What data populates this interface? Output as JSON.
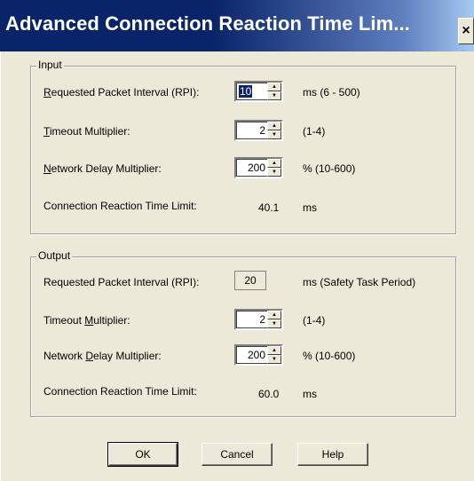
{
  "window": {
    "title": "Advanced Connection Reaction Time Lim...",
    "close_label": "×"
  },
  "input": {
    "legend": "Input",
    "rpi": {
      "label_pre": "",
      "label_ul": "R",
      "label_post": "equested Packet Interval (RPI):",
      "value": "10",
      "units": "ms (6 - 500)"
    },
    "timeout": {
      "label_pre": "",
      "label_ul": "T",
      "label_post": "imeout Multiplier:",
      "value": "2",
      "units": "(1-4)"
    },
    "delay": {
      "label_pre": "",
      "label_ul": "N",
      "label_post": "etwork Delay Multiplier:",
      "value": "200",
      "units": "% (10-600)"
    },
    "crtl": {
      "label": "Connection Reaction Time Limit:",
      "value": "40.1",
      "units": "ms"
    }
  },
  "output": {
    "legend": "Output",
    "rpi": {
      "label": "Requested Packet Interval (RPI):",
      "value": "20",
      "units": "ms (Safety Task Period)"
    },
    "timeout": {
      "label_pre": "Timeout ",
      "label_ul": "M",
      "label_post": "ultiplier:",
      "value": "2",
      "units": "(1-4)"
    },
    "delay": {
      "label_pre": "Network ",
      "label_ul": "D",
      "label_post": "elay Multiplier:",
      "value": "200",
      "units": "% (10-600)"
    },
    "crtl": {
      "label": "Connection Reaction Time Limit:",
      "value": "60.0",
      "units": "ms"
    }
  },
  "buttons": {
    "ok": "OK",
    "cancel": "Cancel",
    "help": "Help"
  }
}
